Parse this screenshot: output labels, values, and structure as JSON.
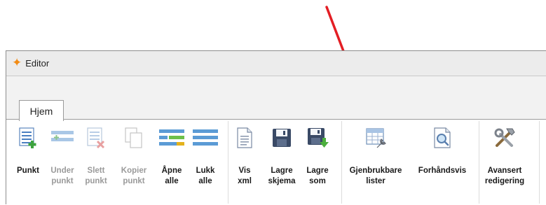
{
  "window": {
    "title": "Editor",
    "accent_color": "#f28b14",
    "title_icon": "star-icon"
  },
  "tabs": [
    {
      "label": "Hjem",
      "active": true
    }
  ],
  "ribbon": {
    "buttons": [
      {
        "id": "punkt",
        "label": "Punkt",
        "icon": "add-item-icon",
        "enabled": true
      },
      {
        "id": "under-punkt",
        "label": "Under\npunkt",
        "icon": "add-subitem-icon",
        "enabled": false
      },
      {
        "id": "slett-punkt",
        "label": "Slett\npunkt",
        "icon": "delete-item-icon",
        "enabled": false
      },
      {
        "id": "kopier-punkt",
        "label": "Kopier\npunkt",
        "icon": "copy-icon",
        "enabled": false
      },
      {
        "id": "apne-alle",
        "label": "Åpne\nalle",
        "icon": "expand-all-icon",
        "enabled": true
      },
      {
        "id": "lukk-alle",
        "label": "Lukk\nalle",
        "icon": "collapse-all-icon",
        "enabled": true
      },
      {
        "id": "vis-xml",
        "label": "Vis\nxml",
        "icon": "document-icon",
        "enabled": true
      },
      {
        "id": "lagre-skjema",
        "label": "Lagre\nskjema",
        "icon": "save-icon",
        "enabled": true
      },
      {
        "id": "lagre-som",
        "label": "Lagre\nsom",
        "icon": "save-as-icon",
        "enabled": true
      },
      {
        "id": "gjenbrukbare-lister",
        "label": "Gjenbrukbare\nlister",
        "icon": "reusable-lists-icon",
        "enabled": true
      },
      {
        "id": "forhandsvis",
        "label": "Forhåndsvis",
        "icon": "preview-icon",
        "enabled": true
      },
      {
        "id": "avansert-redigering",
        "label": "Avansert\nredigering",
        "icon": "tools-icon",
        "enabled": true
      }
    ]
  },
  "annotation": {
    "arrow_color": "#e31e24",
    "arrow_icon": "red-arrow-icon"
  }
}
